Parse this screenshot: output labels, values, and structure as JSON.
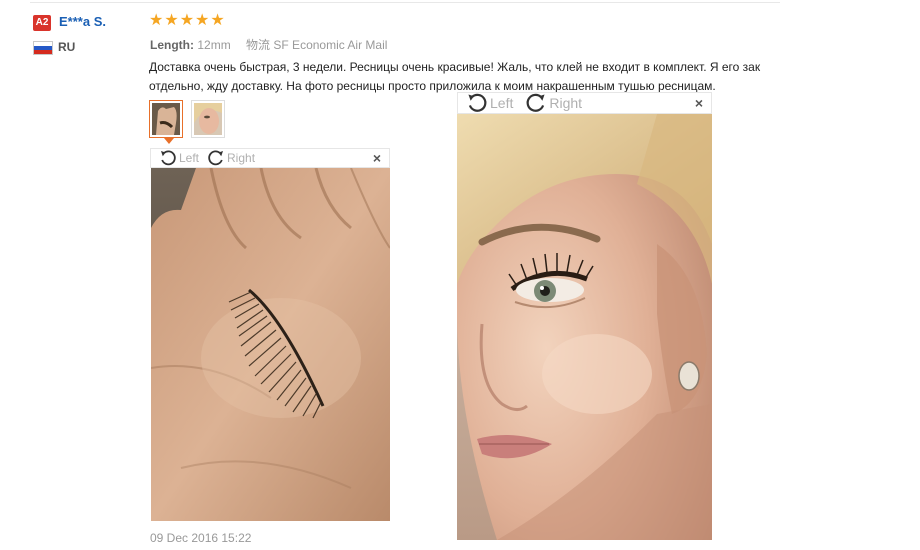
{
  "reviewer": {
    "level": "A2",
    "name": "E***a S.",
    "country": "RU",
    "level_color": "#d9342b",
    "name_color": "#1a5fb4",
    "flag_icon": "russia-flag-icon"
  },
  "review": {
    "rating": 5,
    "stars": [
      "★",
      "★",
      "★",
      "★",
      "★"
    ],
    "star_color": "#f5a623",
    "length_label": "Length:",
    "length_value": "12mm",
    "shipping_label": "物流",
    "shipping_value": "SF Economic Air Mail",
    "text": "Доставка очень быстрая, 3 недели. Ресницы очень красивые! Жаль, что клей не входит в комплект. Я его зак отдельно, жду доставку. На фото ресницы просто приложила к моим накрашенным тушью ресницам.",
    "date": "09 Dec 2016 15:22"
  },
  "viewer": {
    "left_label": "Left",
    "right_label": "Right",
    "close_label": "×"
  },
  "photos": [
    {
      "thumb_icon": "lash-on-palm-thumbnail",
      "active": true
    },
    {
      "thumb_icon": "woman-face-thumbnail",
      "active": false
    }
  ]
}
